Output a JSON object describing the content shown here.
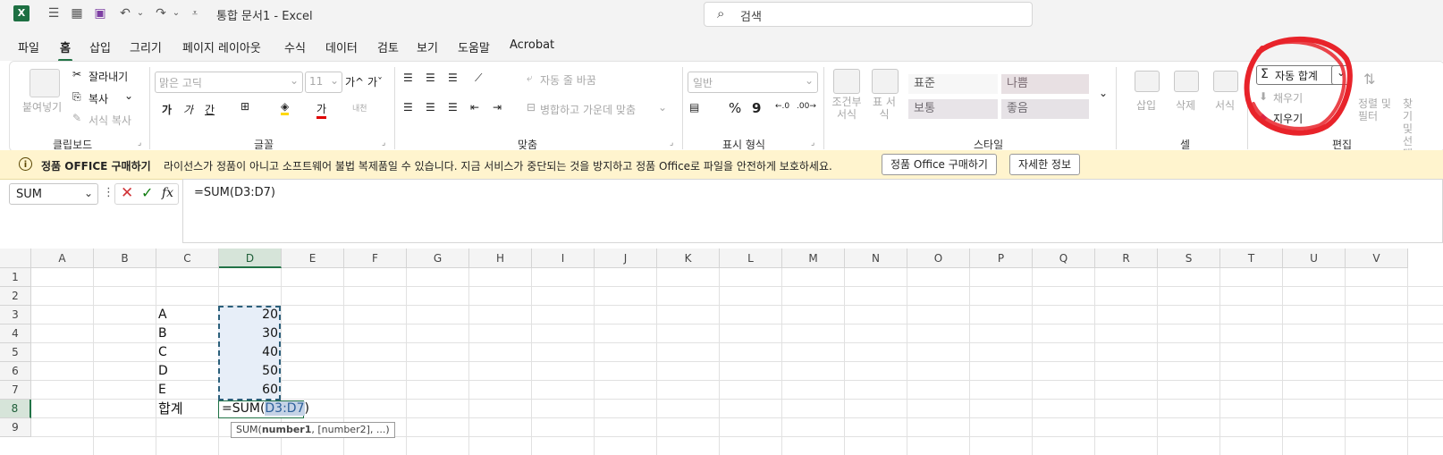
{
  "titlebar": {
    "title": "통합 문서1  -  Excel",
    "search_placeholder": "검색",
    "icons": [
      "excel-logo-icon",
      "menu-lines-icon",
      "table-icon",
      "save-icon",
      "undo-icon",
      "redo-icon",
      "customize-icon"
    ]
  },
  "menu": {
    "tabs": [
      "파일",
      "홈",
      "삽입",
      "그리기",
      "페이지 레이아웃",
      "수식",
      "데이터",
      "검토",
      "보기",
      "도움말",
      "Acrobat"
    ],
    "active": "홈"
  },
  "ribbon": {
    "clipboard": {
      "label": "클립보드",
      "paste": "붙여넣기",
      "cut": "잘라내기",
      "copy": "복사",
      "format_painter": "서식 복사"
    },
    "font": {
      "label": "글꼴",
      "font_name": "맑은 고딕",
      "font_size": "11",
      "grow": "가^",
      "shrink": "가ˇ",
      "bold": "가",
      "italic": "가",
      "underline": "간",
      "font_color": "가",
      "phonetic": "내천"
    },
    "alignment": {
      "label": "맞춤",
      "wrap": "자동 줄 바꿈",
      "merge": "병합하고 가운데 맞춤"
    },
    "number": {
      "label": "표시 형식",
      "format": "일반",
      "percent": "%",
      "comma": "9"
    },
    "styles": {
      "label": "스타일",
      "cond_format": "조건부 서식",
      "table_format": "표 서식",
      "cells": [
        "표준",
        "나쁨",
        "보통",
        "좋음"
      ]
    },
    "cells": {
      "label": "셀",
      "insert": "삽입",
      "delete": "삭제",
      "format": "서식"
    },
    "editing": {
      "label": "편집",
      "autosum": "자동 합계",
      "fill": "채우기",
      "clear": "지우기",
      "sort": "정렬 및 필터",
      "find": "찾기 및 선택"
    }
  },
  "infobar": {
    "title": "정품 OFFICE 구매하기",
    "message": "라이선스가 정품이 아니고 소프트웨어 불법 복제품일 수 있습니다. 지금 서비스가 중단되는 것을 방지하고 정품 Office로 파일을 안전하게 보호하세요.",
    "buy_button": "정품 Office 구매하기",
    "details_button": "자세한 정보"
  },
  "formula_bar": {
    "name_box": "SUM",
    "fx": "fx",
    "formula": "=SUM(D3:D7)"
  },
  "sheet": {
    "columns": [
      "A",
      "B",
      "C",
      "D",
      "E",
      "F",
      "G",
      "H",
      "I",
      "J",
      "K",
      "L",
      "M",
      "N",
      "O",
      "P",
      "Q",
      "R",
      "S",
      "T",
      "U",
      "V"
    ],
    "rows": [
      "1",
      "2",
      "3",
      "4",
      "5",
      "6",
      "7",
      "8",
      "9"
    ],
    "labels": [
      "A",
      "B",
      "C",
      "D",
      "E"
    ],
    "values": [
      "20",
      "30",
      "40",
      "50",
      "60"
    ],
    "total_label": "합계",
    "editing_prefix": "=SUM(",
    "editing_ref": "D3:D7",
    "editing_suffix": ")",
    "tooltip_fn": "SUM(",
    "tooltip_arg1": "number1",
    "tooltip_rest": ", [number2], ...)"
  },
  "colors": {
    "accent": "#217346",
    "annotation": "#e8232a",
    "infobar": "#fff4ce",
    "selection": "#e7eef8"
  }
}
